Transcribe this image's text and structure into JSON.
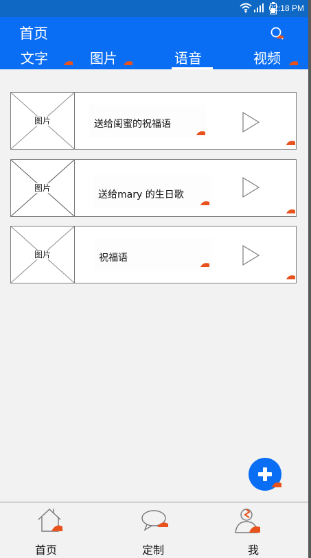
{
  "status_bar": {
    "time": "02:18 PM"
  },
  "header": {
    "title": "首页",
    "tabs": [
      "文字",
      "图片",
      "语音",
      "视频"
    ],
    "active_tab_index": 2
  },
  "voice_list": [
    {
      "thumbnail_label": "图片",
      "title": "送给闺蜜的祝福语"
    },
    {
      "thumbnail_label": "图片",
      "title": "送给mary 的生日歌"
    },
    {
      "thumbnail_label": "图片",
      "title": "祝福语"
    }
  ],
  "bottom_nav": [
    {
      "label": "首页",
      "icon": "home-icon"
    },
    {
      "label": "定制",
      "icon": "chat-bubble-icon"
    },
    {
      "label": "我",
      "icon": "user-icon"
    }
  ],
  "colors": {
    "header": "#0a6ef5",
    "status_bar": "#0f68c4",
    "fab": "#0a6ef5",
    "annotation_mark": "#e8521c"
  }
}
